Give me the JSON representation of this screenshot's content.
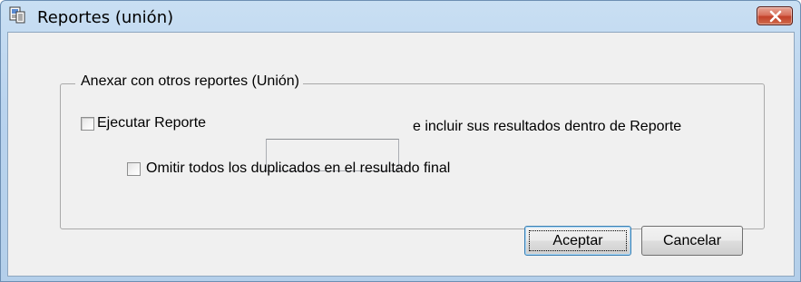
{
  "window": {
    "title": "Reportes (unión)",
    "icons": {
      "app": "report-window-icon",
      "close": "close-icon"
    },
    "colors": {
      "close_button": "#c7452d",
      "titlebar": "#b9d3ee"
    }
  },
  "group": {
    "label": "Anexar con otros reportes (Unión)"
  },
  "execute_report": {
    "label": "Ejecutar Reporte",
    "checked": false,
    "input_value": "",
    "suffix_text": "e incluir sus resultados dentro de Reporte"
  },
  "omit_duplicates": {
    "label": "Omitir todos los duplicados en el resultado final",
    "checked": false
  },
  "buttons": {
    "accept": "Aceptar",
    "cancel": "Cancelar"
  }
}
